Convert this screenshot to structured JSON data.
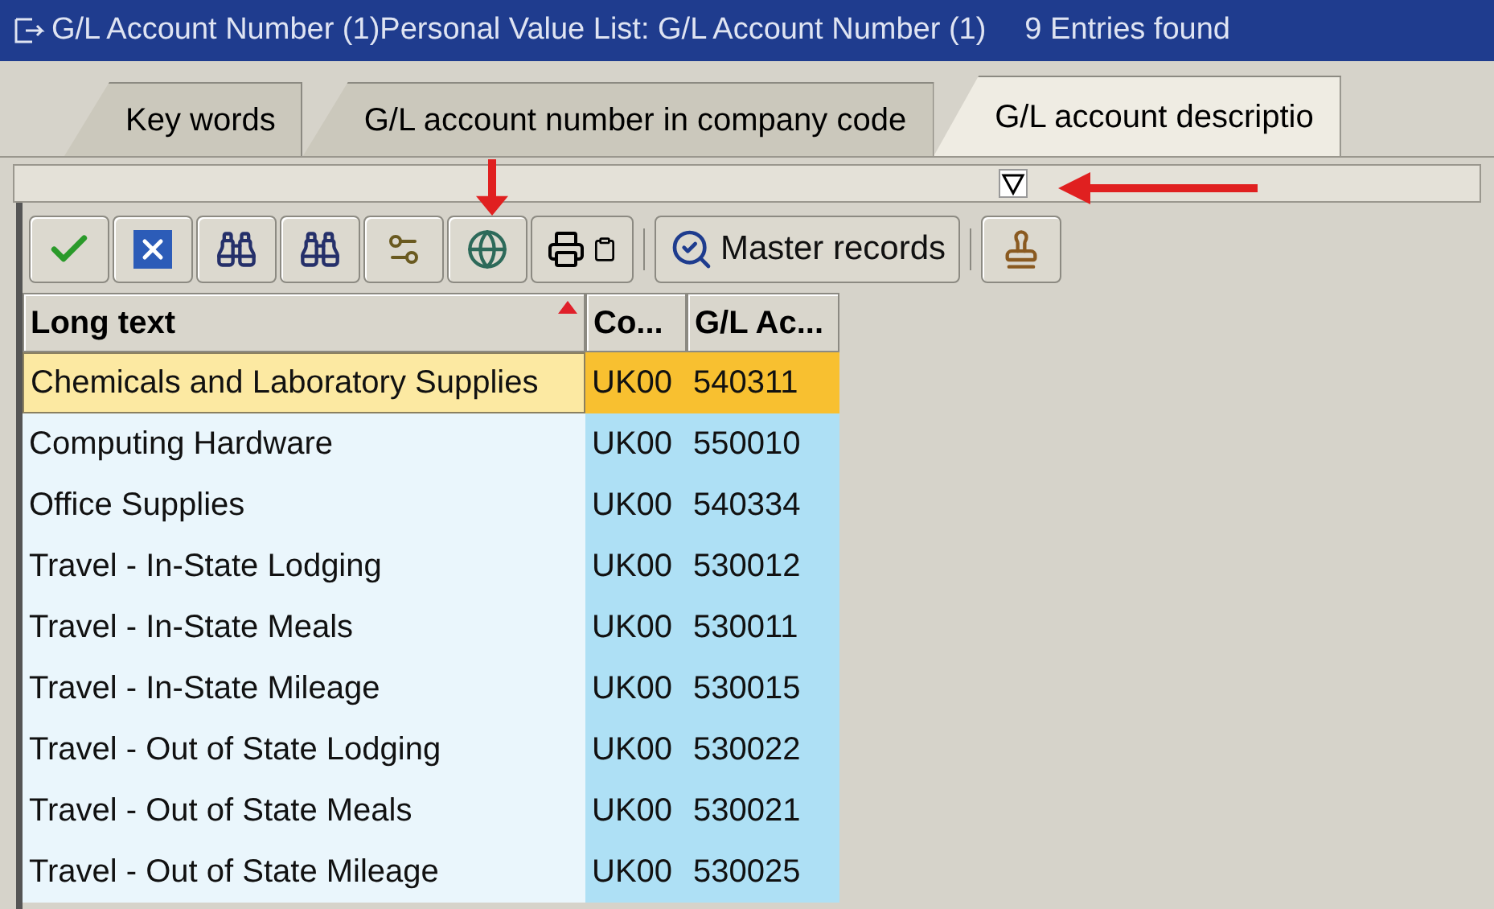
{
  "window": {
    "title": "G/L Account Number (1)Personal Value List: G/L Account Number (1)",
    "entries": "9 Entries found"
  },
  "tabs": [
    {
      "label": "Key words",
      "selected": false
    },
    {
      "label": "G/L account number in company code",
      "selected": false
    },
    {
      "label": "G/L account descriptio",
      "selected": true
    }
  ],
  "toolbar": {
    "master_records": "Master records"
  },
  "table": {
    "columns": [
      {
        "label": "Long text",
        "sorted": true
      },
      {
        "label": "Co...",
        "sorted": false
      },
      {
        "label": "G/L Ac...",
        "sorted": false
      }
    ],
    "rows": [
      {
        "cells": [
          "Chemicals and Laboratory Supplies",
          "UK00",
          "540311"
        ],
        "selected": true
      },
      {
        "cells": [
          "Computing Hardware",
          "UK00",
          "550010"
        ],
        "selected": false
      },
      {
        "cells": [
          "Office Supplies",
          "UK00",
          "540334"
        ],
        "selected": false
      },
      {
        "cells": [
          "Travel - In-State Lodging",
          "UK00",
          "530012"
        ],
        "selected": false
      },
      {
        "cells": [
          "Travel - In-State Meals",
          "UK00",
          "530011"
        ],
        "selected": false
      },
      {
        "cells": [
          "Travel - In-State Mileage",
          "UK00",
          "530015"
        ],
        "selected": false
      },
      {
        "cells": [
          "Travel - Out of State Lodging",
          "UK00",
          "530022"
        ],
        "selected": false
      },
      {
        "cells": [
          "Travel - Out of State Meals",
          "UK00",
          "530021"
        ],
        "selected": false
      },
      {
        "cells": [
          "Travel - Out of State Mileage",
          "UK00",
          "530025"
        ],
        "selected": false
      }
    ]
  }
}
